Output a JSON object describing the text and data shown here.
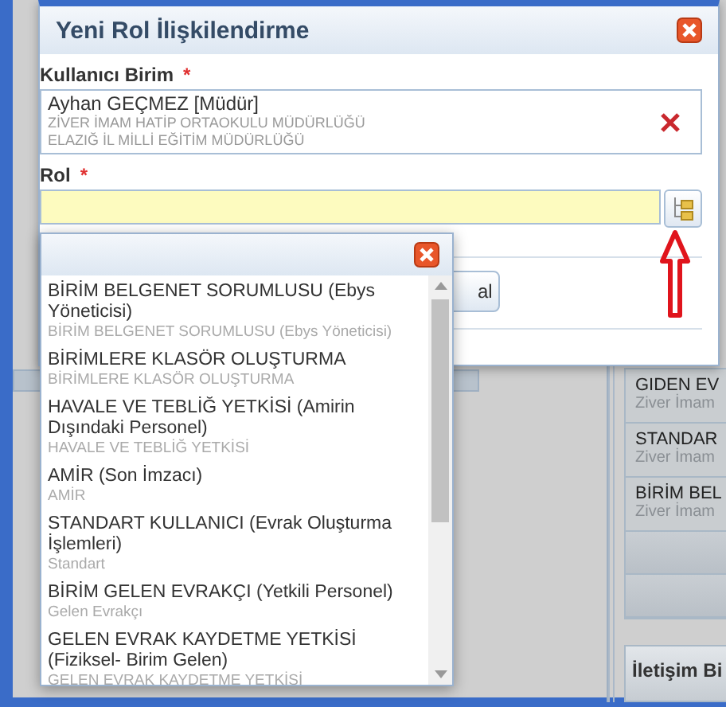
{
  "background": {
    "panel_items": [
      {
        "title": "GIDEN EV",
        "subtitle": "Ziver İmam"
      },
      {
        "title": "STANDAR",
        "subtitle": "Ziver İmam"
      },
      {
        "title": "BİRİM BEL",
        "subtitle": "Ziver İmam"
      }
    ],
    "section_title": "İletişim Bi"
  },
  "dialog": {
    "title": "Yeni Rol İlişkilendirme",
    "user_unit": {
      "label": "Kullanıcı Birim",
      "required_mark": "*",
      "name": "Ayhan GEÇMEZ [Müdür]",
      "lines": [
        "ZİVER İMAM HATİP ORTAOKULU MÜDÜRLÜĞÜ",
        "ELAZIĞ İL MİLLİ EĞİTİM MÜDÜRLÜĞÜ"
      ]
    },
    "role": {
      "label": "Rol",
      "required_mark": "*"
    },
    "button": "al"
  },
  "popup": {
    "items": [
      {
        "title": "BİRİM BELGENET SORUMLUSU (Ebys Yöneticisi)",
        "subtitle": "BİRİM BELGENET SORUMLUSU (Ebys Yöneticisi)"
      },
      {
        "title": "BİRİMLERE KLASÖR OLUŞTURMA",
        "subtitle": "BİRİMLERE KLASÖR OLUŞTURMA"
      },
      {
        "title": "HAVALE VE TEBLİĞ YETKİSİ (Amirin Dışındaki Personel)",
        "subtitle": "HAVALE VE TEBLİĞ YETKİSİ"
      },
      {
        "title": "AMİR (Son İmzacı)",
        "subtitle": "AMİR"
      },
      {
        "title": "STANDART KULLANICI (Evrak Oluşturma İşlemleri)",
        "subtitle": "Standart"
      },
      {
        "title": "BİRİM GELEN EVRAKÇI (Yetkili Personel)",
        "subtitle": "Gelen Evrakçı"
      },
      {
        "title": "GELEN EVRAK KAYDETME YETKİSİ (Fiziksel- Birim Gelen)",
        "subtitle": "GELEN EVRAK KAYDETME YETKİSİ"
      }
    ]
  }
}
